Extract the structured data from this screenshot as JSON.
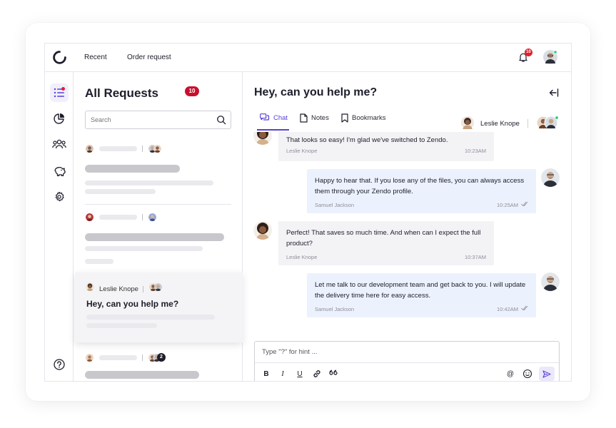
{
  "nav": {
    "recent": "Recent",
    "order_request": "Order request",
    "notification_count": "10"
  },
  "rail": {
    "icons": [
      "list-icon",
      "pie-chart-icon",
      "team-icon",
      "piggy-bank-icon",
      "gear-icon",
      "help-icon"
    ]
  },
  "requests": {
    "title": "All Requests",
    "count": "10",
    "search_placeholder": "Search",
    "selected": {
      "requester": "Leslie Knope",
      "subject": "Hey, can you help me?"
    },
    "extra_participants": "2"
  },
  "chat": {
    "title": "Hey, can you help me?",
    "tabs": [
      "Chat",
      "Notes",
      "Bookmarks"
    ],
    "assignee": "Leslie Knope",
    "messages": [
      {
        "direction": "in",
        "text": "That looks so easy! I'm glad we've switched to Zendo.",
        "author": "Leslie Knope",
        "time": "10:23AM"
      },
      {
        "direction": "out",
        "text": "Happy to hear that. If you lose any of the files, you can always access them through your Zendo profile.",
        "author": "Samuel Jackson",
        "time": "10:25AM"
      },
      {
        "direction": "in",
        "text": "Perfect! That saves so much time. And when can I expect the full product?",
        "author": "Leslie Knope",
        "time": "10:37AM"
      },
      {
        "direction": "out",
        "text": "Let me talk to our development team and get back to you. I will update the delivery time here for easy access.",
        "author": "Samuel Jackson",
        "time": "10:42AM"
      }
    ],
    "composer_placeholder": "Type \"?\" for hint ..."
  },
  "colors": {
    "accent": "#5b3fd6",
    "badge": "#e0212e",
    "incoming_bg": "#f3f3f6",
    "outgoing_bg": "#ecf2fd"
  }
}
